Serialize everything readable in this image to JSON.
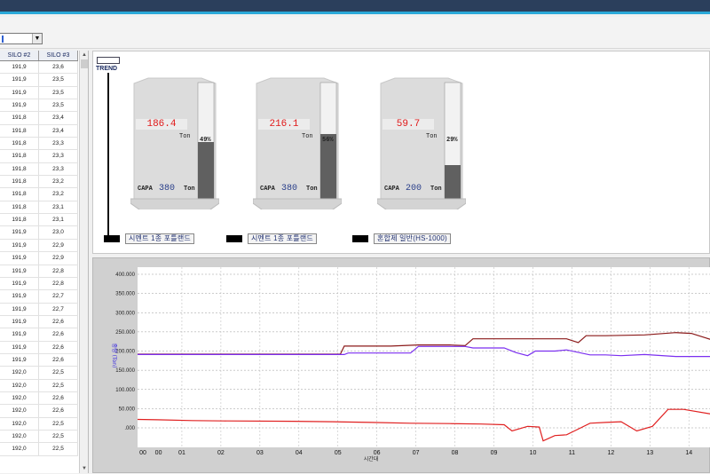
{
  "toolbar": {
    "combo_arrow": "▼"
  },
  "table": {
    "headers": [
      "SILO #2",
      "SILO #3"
    ],
    "rows": [
      [
        "191,9",
        "23,6"
      ],
      [
        "191,9",
        "23,5"
      ],
      [
        "191,9",
        "23,5"
      ],
      [
        "191,9",
        "23,5"
      ],
      [
        "191,8",
        "23,4"
      ],
      [
        "191,8",
        "23,4"
      ],
      [
        "191,8",
        "23,3"
      ],
      [
        "191,8",
        "23,3"
      ],
      [
        "191,8",
        "23,3"
      ],
      [
        "191,8",
        "23,2"
      ],
      [
        "191,8",
        "23,2"
      ],
      [
        "191,8",
        "23,1"
      ],
      [
        "191,8",
        "23,1"
      ],
      [
        "191,9",
        "23,0"
      ],
      [
        "191,9",
        "22,9"
      ],
      [
        "191,9",
        "22,9"
      ],
      [
        "191,9",
        "22,8"
      ],
      [
        "191,9",
        "22,8"
      ],
      [
        "191,9",
        "22,7"
      ],
      [
        "191,9",
        "22,7"
      ],
      [
        "191,9",
        "22,6"
      ],
      [
        "191,9",
        "22,6"
      ],
      [
        "191,9",
        "22,6"
      ],
      [
        "191,9",
        "22,6"
      ],
      [
        "192,0",
        "22,5"
      ],
      [
        "192,0",
        "22,5"
      ],
      [
        "192,0",
        "22,6"
      ],
      [
        "192,0",
        "22,6"
      ],
      [
        "192,0",
        "22,5"
      ],
      [
        "192,0",
        "22,5"
      ],
      [
        "192,0",
        "22,5"
      ]
    ]
  },
  "trend": {
    "label": "TREND"
  },
  "silos": [
    {
      "value": "186.4",
      "unit": "Ton",
      "percent": "49%",
      "fill_fraction": 0.49,
      "capa_label": "CAPA",
      "capa": "380",
      "capa_unit": "Ton",
      "name": "시멘트 1종 포틀랜드"
    },
    {
      "value": "216.1",
      "unit": "Ton",
      "percent": "56%",
      "fill_fraction": 0.56,
      "capa_label": "CAPA",
      "capa": "380",
      "capa_unit": "Ton",
      "name": "시멘트 1종 포틀랜드"
    },
    {
      "value": "59.7",
      "unit": "Ton",
      "percent": "29%",
      "fill_fraction": 0.29,
      "capa_label": "CAPA",
      "capa": "200",
      "capa_unit": "Ton",
      "name": "혼합제 일반(HS-1000)"
    }
  ],
  "chart_data": {
    "type": "line",
    "ylabel": "중량 (Ton)",
    "xlabel": "시간대",
    "ylim": [
      0,
      400
    ],
    "y_ticks": [
      "400.000",
      "350.000",
      "300.000",
      "250.000",
      "200.000",
      "150.000",
      "100.000",
      "50.000",
      ".000"
    ],
    "x_ticks": [
      "00",
      "00",
      "01",
      "02",
      "03",
      "04",
      "05",
      "06",
      "07",
      "08",
      "09",
      "10",
      "11",
      "12",
      "13",
      "14"
    ],
    "x_tick_hours": [
      0,
      0.4,
      1,
      2,
      3,
      4,
      5,
      6,
      7,
      8,
      9,
      10,
      11,
      12,
      13,
      14
    ],
    "xlim": [
      0,
      14.7
    ],
    "grid": true,
    "series": [
      {
        "color": "#8b1a1a",
        "x": [
          0,
          5.2,
          5.3,
          6.5,
          7.2,
          8.0,
          8.4,
          8.6,
          9.0,
          10.0,
          11.0,
          11.3,
          11.5,
          12.0,
          13.0,
          13.8,
          14.2,
          14.7
        ],
        "values": [
          192,
          192,
          213,
          213,
          216,
          216,
          214,
          232,
          232,
          232,
          232,
          222,
          240,
          240,
          242,
          248,
          246,
          230
        ]
      },
      {
        "color": "#7b2ff0",
        "x": [
          0,
          5.3,
          5.4,
          7.0,
          7.2,
          8.4,
          8.6,
          9.4,
          9.7,
          10.0,
          10.2,
          10.7,
          11.0,
          11.6,
          12.0,
          12.4,
          13.0,
          13.8,
          14.7
        ],
        "values": [
          191,
          191,
          195,
          195,
          212,
          212,
          208,
          208,
          196,
          188,
          200,
          200,
          203,
          190,
          190,
          188,
          191,
          186,
          186
        ]
      },
      {
        "color": "#e02020",
        "x": [
          0,
          0.5,
          1.4,
          2.2,
          4.0,
          5.0,
          6.0,
          7.0,
          8.0,
          8.8,
          9.4,
          9.6,
          10.0,
          10.3,
          10.4,
          10.7,
          11.0,
          11.2,
          11.6,
          12.0,
          12.4,
          12.8,
          13.2,
          13.6,
          14.0,
          14.7
        ],
        "values": [
          22,
          21,
          19,
          18,
          17,
          16,
          14,
          12,
          11,
          10,
          8,
          -8,
          4,
          2,
          -34,
          -20,
          -18,
          -8,
          12,
          14,
          16,
          -8,
          4,
          48,
          48,
          36
        ]
      }
    ]
  }
}
